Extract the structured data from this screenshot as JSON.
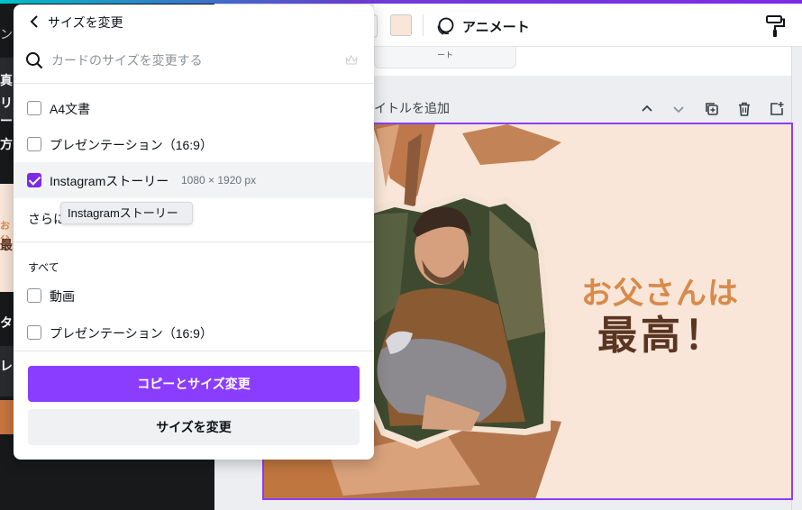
{
  "toolbar": {
    "animate_label": "アニメート",
    "swatch_color": "#f9e6d9",
    "icons": [
      "color-swatch",
      "animate-icon",
      "paint-roller-icon"
    ]
  },
  "page_strip": {
    "fragment": "ート"
  },
  "page_header": {
    "title_placeholder": "イトルを追加",
    "icons": [
      "chevron-up-icon",
      "chevron-down-icon",
      "duplicate-page-icon",
      "trash-icon",
      "add-page-icon"
    ]
  },
  "left_panel": {
    "fragments": [
      "ン",
      "真",
      "リー",
      "方の",
      "タ",
      "レ"
    ],
    "thumb_fragment_1": "お父",
    "thumb_fragment_2": "最"
  },
  "canvas": {
    "line1": "お父さんは",
    "line2": "最高！",
    "bg_color": "#f9e6d9"
  },
  "resize_panel": {
    "title": "サイズを変更",
    "search_placeholder": "カードのサイズを変更する",
    "suggested": [
      {
        "label": "A4文書",
        "checked": false,
        "dims": ""
      },
      {
        "label": "プレゼンテーション（16:9）",
        "checked": false,
        "dims": ""
      },
      {
        "label": "Instagramストーリー",
        "checked": true,
        "dims": "1080 × 1920 px"
      }
    ],
    "more_text": "さらに",
    "tooltip": "Instagramストーリー",
    "all_section_label": "すべて",
    "all_items": [
      {
        "label": "動画",
        "checked": false
      },
      {
        "label": "プレゼンテーション（16:9）",
        "checked": false
      }
    ],
    "copy_resize_button": "コピーとサイズ変更",
    "resize_button": "サイズを変更",
    "accent_color": "#8b3dff"
  }
}
